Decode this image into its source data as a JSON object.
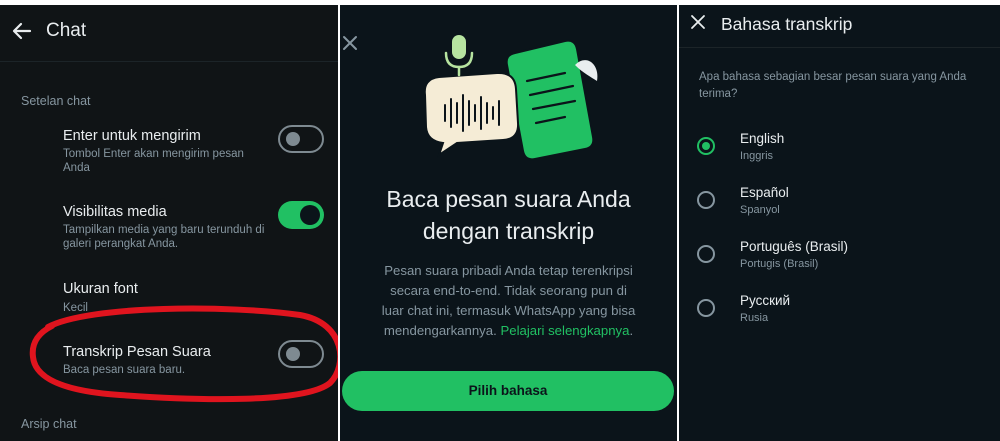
{
  "chat_settings": {
    "title": "Chat",
    "section_chat_settings": "Setelan chat",
    "enter_to_send": {
      "title": "Enter untuk mengirim",
      "subtitle": "Tombol Enter akan mengirim pesan Anda",
      "enabled": false
    },
    "media_visibility": {
      "title": "Visibilitas media",
      "subtitle": "Tampilkan media yang baru terunduh di galeri perangkat Anda.",
      "enabled": true
    },
    "font_size": {
      "title": "Ukuran font",
      "value": "Kecil"
    },
    "voice_transcripts": {
      "title": "Transkrip Pesan Suara",
      "subtitle": "Baca pesan suara baru.",
      "enabled": false
    },
    "section_chat_archive": "Arsip chat"
  },
  "intro": {
    "heading_line1": "Baca pesan suara Anda",
    "heading_line2": "dengan transkrip",
    "body_line1": "Pesan suara pribadi Anda tetap terenkripsi",
    "body_line2": "secara end-to-end. Tidak seorang pun di",
    "body_line3": "luar chat ini, termasuk WhatsApp yang bisa",
    "body_line4_text": "mendengarkannya. ",
    "learn_more_link": "Pelajari selengkapnya",
    "body_line4_end": ".",
    "primary_button": "Pilih bahasa"
  },
  "language_picker": {
    "title": "Bahasa transkrip",
    "question": "Apa bahasa sebagian besar pesan suara yang Anda terima?",
    "options": [
      {
        "name": "English",
        "native": "Inggris",
        "selected": true
      },
      {
        "name": "Español",
        "native": "Spanyol",
        "selected": false
      },
      {
        "name": "Português (Brasil)",
        "native": "Portugis (Brasil)",
        "selected": false
      },
      {
        "name": "Русский",
        "native": "Rusia",
        "selected": false
      }
    ]
  },
  "colors": {
    "accent_green": "#21c063",
    "background": "#0b141a",
    "secondary_text": "#8696a0",
    "annotation_red": "#e0141e"
  }
}
